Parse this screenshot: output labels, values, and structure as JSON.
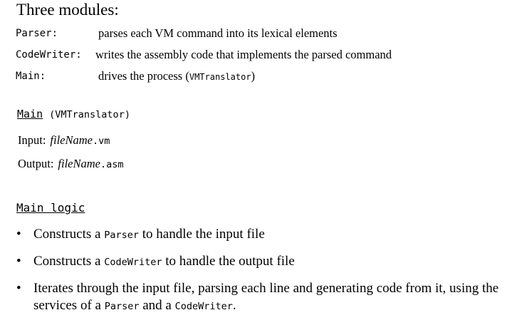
{
  "title": "Three modules:",
  "modules": [
    {
      "name": "Parser:",
      "description": "parses each VM command into its lexical elements"
    },
    {
      "name": "CodeWriter:",
      "description": "writes the assembly code that implements the parsed command"
    },
    {
      "name": "Main:",
      "description_pre": "drives the process (",
      "description_code": "VMTranslator",
      "description_post": ")"
    }
  ],
  "main_section": {
    "heading": "Main",
    "heading_paren": "(VMTranslator)",
    "input_label": "Input:",
    "input_file": "fileName",
    "input_ext": ".vm",
    "output_label": "Output:",
    "output_file": "fileName",
    "output_ext": ".asm"
  },
  "logic": {
    "heading": "Main logic",
    "bullets": [
      {
        "pre": "Constructs a ",
        "code": "Parser",
        "post": " to handle the input file"
      },
      {
        "pre": "Constructs a ",
        "code": "CodeWriter",
        "post": " to handle the output file"
      },
      {
        "pre": "Iterates through the input file, parsing each line and generating code from it, using the services of a ",
        "code": "Parser",
        "mid": " and a ",
        "code2": "CodeWriter",
        "post": "."
      }
    ]
  }
}
